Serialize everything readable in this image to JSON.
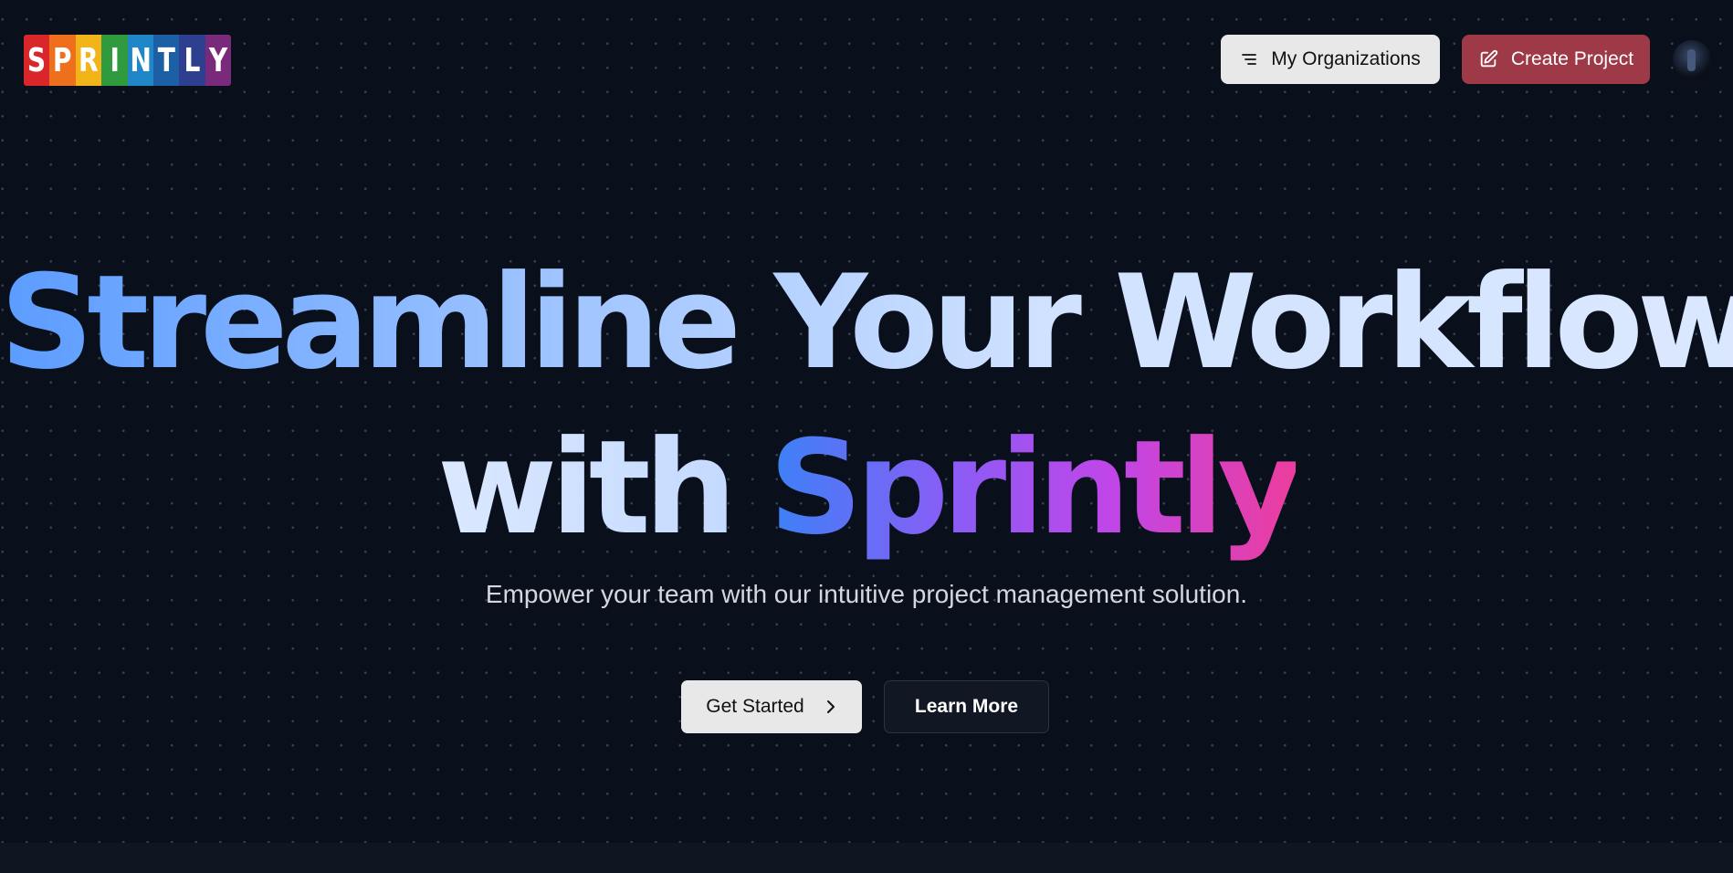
{
  "header": {
    "logo_letters": [
      {
        "char": "S",
        "color": "#d9262b"
      },
      {
        "char": "P",
        "color": "#ee6f1c"
      },
      {
        "char": "R",
        "color": "#f1b51a"
      },
      {
        "char": "I",
        "color": "#2f9a3e"
      },
      {
        "char": "N",
        "color": "#1f86c8"
      },
      {
        "char": "T",
        "color": "#1d5fa4"
      },
      {
        "char": "L",
        "color": "#2f3f8f"
      },
      {
        "char": "Y",
        "color": "#7a2a7a"
      }
    ],
    "orgs_button": {
      "label": "My Organizations",
      "icon": "list-filter-icon"
    },
    "create_button": {
      "label": "Create Project",
      "icon": "edit-icon"
    },
    "avatar": {
      "icon": "user-avatar"
    }
  },
  "hero": {
    "headline_line1": "Streamline Your Workflow",
    "headline_with": "with",
    "headline_brand": "Sprintly",
    "subtitle": "Empower your team with our intuitive project management solution.",
    "get_started_label": "Get Started",
    "learn_more_label": "Learn More"
  },
  "colors": {
    "background": "#0a101b",
    "create_button": "#9e3a48",
    "light_button": "#e8e8e8"
  }
}
